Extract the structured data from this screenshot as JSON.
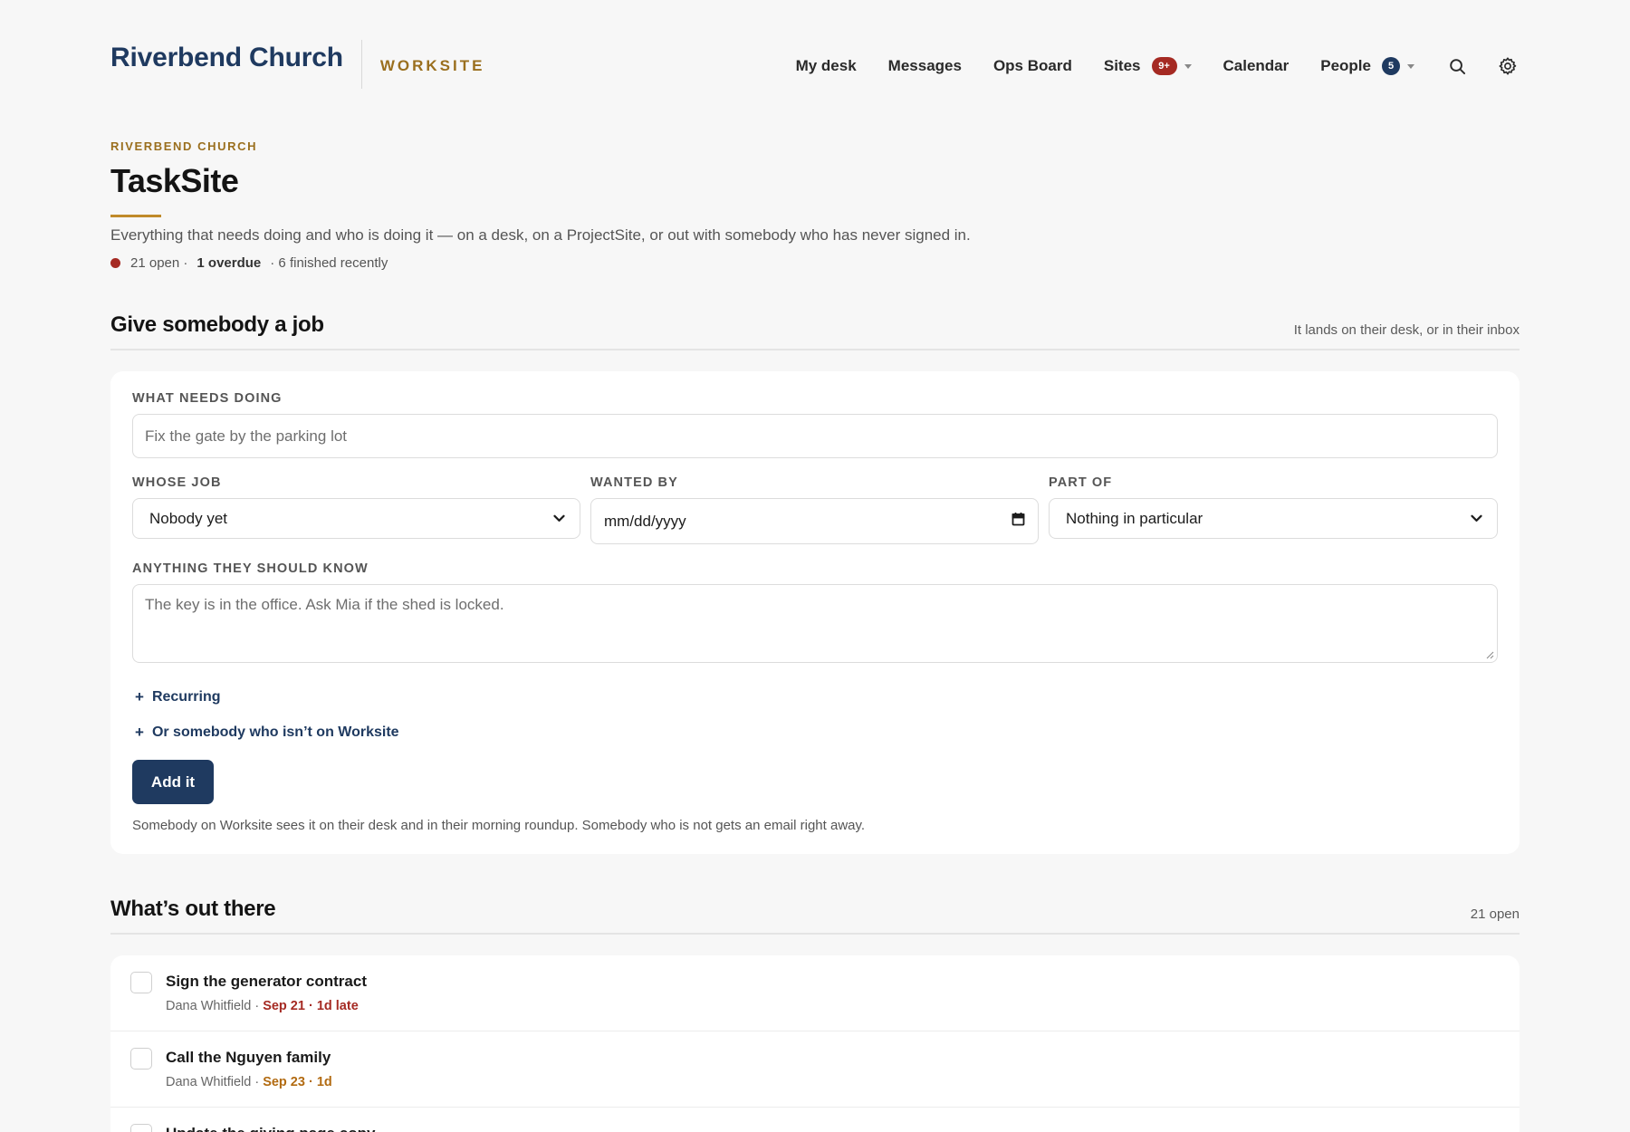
{
  "header": {
    "brand": "Riverbend Church",
    "product": "WORKSITE",
    "nav": [
      {
        "label": "My desk"
      },
      {
        "label": "Messages"
      },
      {
        "label": "Ops Board"
      },
      {
        "label": "Sites",
        "badge": "9+"
      },
      {
        "label": "Calendar"
      },
      {
        "label": "People",
        "badge": "5"
      }
    ],
    "icons": [
      "search-icon",
      "gear-icon"
    ]
  },
  "page": {
    "eyebrow": "RIVERBEND CHURCH",
    "title": "TaskSite",
    "description": "Everything that needs doing and who is doing it — on a desk, on a ProjectSite, or out with somebody who has never signed in.",
    "stats": {
      "open": "21 open ·",
      "overdue": "1 overdue",
      "finished": "· 6 finished recently"
    }
  },
  "form_section": {
    "title": "Give somebody a job",
    "note": "It lands on their desk, or in their inbox",
    "what_label": "WHAT NEEDS DOING",
    "what_placeholder": "Fix the gate by the parking lot",
    "whose_label": "WHOSE JOB",
    "whose_value": "Nobody yet",
    "wanted_label": "WANTED BY",
    "wanted_placeholder": "mm/dd/yyyy",
    "partof_label": "PART OF",
    "partof_value": "Nothing in particular",
    "notes_label": "ANYTHING THEY SHOULD KNOW",
    "notes_placeholder": "The key is in the office. Ask Mia if the shed is locked.",
    "recurring_link": "Recurring",
    "outside_link": "Or somebody who isn’t on Worksite",
    "submit_label": "Add it",
    "help": "Somebody on Worksite sees it on their desk and in their morning roundup. Somebody who is not gets an email right away."
  },
  "list_section": {
    "title": "What’s out there",
    "count": "21 open",
    "tasks": [
      {
        "title": "Sign the generator contract",
        "owner": "Dana Whitfield ·",
        "due": "Sep 21 · 1d late",
        "status": "late"
      },
      {
        "title": "Call the Nguyen family",
        "owner": "Dana Whitfield ·",
        "due": "Sep 23 · 1d",
        "status": "soon"
      },
      {
        "title": "Update the giving page copy",
        "owner": "",
        "due": "",
        "status": ""
      }
    ]
  },
  "colors": {
    "brand": "#1f3a60",
    "accent": "#9a6f1e",
    "overdue": "#a52a23",
    "due_soon": "#b26b12"
  }
}
